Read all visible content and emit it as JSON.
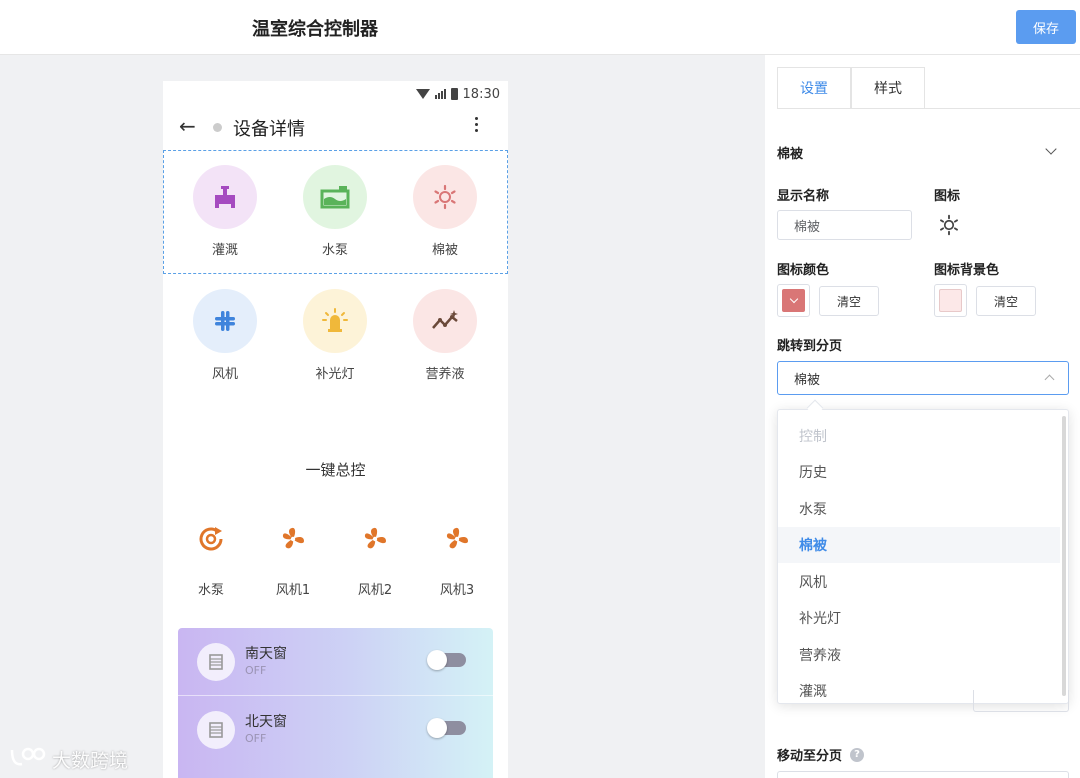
{
  "app": {
    "title": "温室综合控制器",
    "save_label": "保存"
  },
  "phone": {
    "time": "18:30",
    "page_title": "设备详情",
    "devices": [
      {
        "label": "灌溉",
        "icon": "valve-icon",
        "color": "#a54bc0",
        "bg": "#f3e3f7"
      },
      {
        "label": "水泵",
        "icon": "pump-icon",
        "color": "#5ab35a",
        "bg": "#e1f5e0"
      },
      {
        "label": "棉被",
        "icon": "sun-gear-icon",
        "color": "#d97676",
        "bg": "#fbe6e5"
      },
      {
        "label": "风机",
        "icon": "slack-icon",
        "color": "#3f84dc",
        "bg": "#e4eefb"
      },
      {
        "label": "补光灯",
        "icon": "lamp-icon",
        "color": "#f0b83a",
        "bg": "#fdf3d8"
      },
      {
        "label": "营养液",
        "icon": "trend-icon",
        "color": "#6b4a3a",
        "bg": "#fbe6e5"
      }
    ],
    "onekey_title": "一键总控",
    "controls": [
      {
        "label": "水泵",
        "icon": "pump-cycle-icon"
      },
      {
        "label": "风机1",
        "icon": "fan-icon"
      },
      {
        "label": "风机2",
        "icon": "fan-icon"
      },
      {
        "label": "风机3",
        "icon": "fan-icon"
      }
    ],
    "control_color": "#e0762a",
    "windows": [
      {
        "name": "南天窗",
        "state": "OFF"
      },
      {
        "name": "北天窗",
        "state": "OFF"
      }
    ]
  },
  "panel": {
    "tabs": [
      "设置",
      "样式"
    ],
    "section": "棉被",
    "display_name_label": "显示名称",
    "display_name_value": "棉被",
    "icon_label": "图标",
    "icon_color_label": "图标颜色",
    "icon_color": "#d97676",
    "icon_bg_label": "图标背景色",
    "icon_bg_color": "#fce8e8",
    "clear_label": "清空",
    "jump_label": "跳转到分页",
    "jump_value": "棉被",
    "options": [
      "控制",
      "历史",
      "水泵",
      "棉被",
      "风机",
      "补光灯",
      "营养液",
      "灌溉"
    ],
    "move_label": "移动至分页",
    "help": "?"
  },
  "watermark": "大数跨境"
}
